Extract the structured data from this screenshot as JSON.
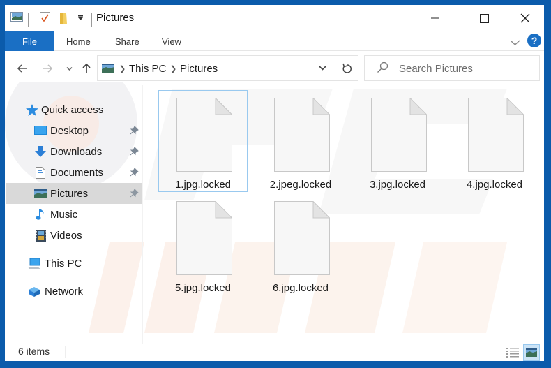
{
  "window": {
    "title": "Pictures",
    "colors": {
      "frame": "#0b5bab",
      "file_tab": "#1a6fc4",
      "help": "#1a6fc4",
      "selected_nav": "#d9d9d9"
    },
    "controls": {
      "minimize": "minimize-icon",
      "maximize": "maximize-icon",
      "close": "close-icon"
    }
  },
  "quick_access_toolbar": [
    "pictures-icon",
    "properties-icon",
    "new-folder-icon",
    "customize-dropdown-icon"
  ],
  "ribbon": {
    "tabs": [
      {
        "label": "File",
        "active": true
      },
      {
        "label": "Home"
      },
      {
        "label": "Share"
      },
      {
        "label": "View"
      }
    ],
    "expand_icon": "chevron-down-icon",
    "help_label": "?"
  },
  "address_bar": {
    "breadcrumbs": [
      "This PC",
      "Pictures"
    ],
    "refresh_icon": "refresh-icon"
  },
  "search": {
    "placeholder": "Search Pictures"
  },
  "sidebar": {
    "quick_access_label": "Quick access",
    "items": [
      {
        "label": "Desktop",
        "icon": "desktop-icon",
        "pinned": true
      },
      {
        "label": "Downloads",
        "icon": "downloads-icon",
        "pinned": true
      },
      {
        "label": "Documents",
        "icon": "documents-icon",
        "pinned": true
      },
      {
        "label": "Pictures",
        "icon": "pictures-icon",
        "pinned": true,
        "selected": true
      },
      {
        "label": "Music",
        "icon": "music-icon"
      },
      {
        "label": "Videos",
        "icon": "videos-icon"
      }
    ],
    "this_pc_label": "This PC",
    "network_label": "Network"
  },
  "files": [
    {
      "name": "1.jpg.locked",
      "focused": true
    },
    {
      "name": "2.jpeg.locked"
    },
    {
      "name": "3.jpg.locked"
    },
    {
      "name": "4.jpg.locked"
    },
    {
      "name": "5.jpg.locked"
    },
    {
      "name": "6.jpg.locked"
    }
  ],
  "status": {
    "item_count": "6 items",
    "views": [
      "details-view-icon",
      "large-icons-view-icon"
    ],
    "active_view": "large-icons-view-icon"
  }
}
